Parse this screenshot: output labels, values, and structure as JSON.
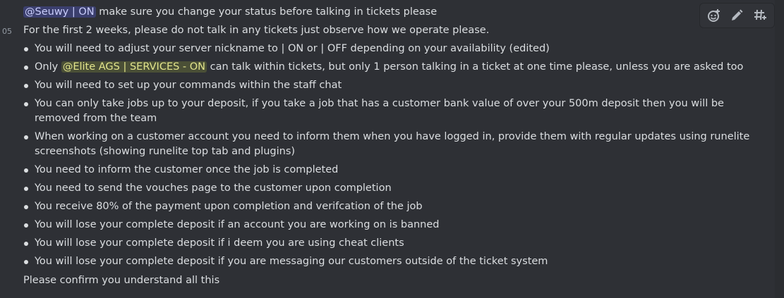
{
  "message": {
    "first_line": {
      "mention": "@Seuwy | ON",
      "text": " make sure you change your status before talking in tickets please"
    },
    "timestamp": "05",
    "intro": "For the first 2 weeks, please do not talk in any tickets just observe how we operate please.",
    "bullets": [
      {
        "text": "You will need to adjust your server nickname to | ON or | OFF depending on your availability (edited)"
      },
      {
        "pre": "Only ",
        "role": "@Elite AGS | SERVICES - ON",
        "post": " can talk within tickets, but only 1 person talking in a ticket at one time please, unless you are asked too"
      },
      {
        "text": "You will need to set up your commands within the staff chat"
      },
      {
        "text": "You can only take jobs up to your deposit, if you take a job that has a customer bank value of over your 500m deposit then you will be removed from the team"
      },
      {
        "text": "When working on a customer account you need to inform them when you have logged in, provide them with regular updates using runelite screenshots (showing runelite top tab and plugins)"
      },
      {
        "text": "You need to inform the customer once the job is completed"
      },
      {
        "text": "You need to send the vouches page to the customer upon completion"
      },
      {
        "text": "You receive 80% of the payment upon completion and verifcation of the job"
      },
      {
        "text": "You will lose your complete deposit if an account you are working on is banned"
      },
      {
        "text": "You will lose your complete deposit if i deem you are using cheat clients"
      },
      {
        "text": "You will lose your complete deposit if you are messaging our customers outside of the ticket system"
      }
    ],
    "closing": "Please confirm you understand all this"
  },
  "toolbar": {
    "icons": [
      "add-reaction-icon",
      "edit-icon",
      "create-thread-icon"
    ]
  },
  "colors": {
    "background": "#2e3035",
    "text": "#dbdee1",
    "mention_bg": "#4a4f8a",
    "role_bg": "#50532f",
    "role_text": "#e2e48c"
  }
}
